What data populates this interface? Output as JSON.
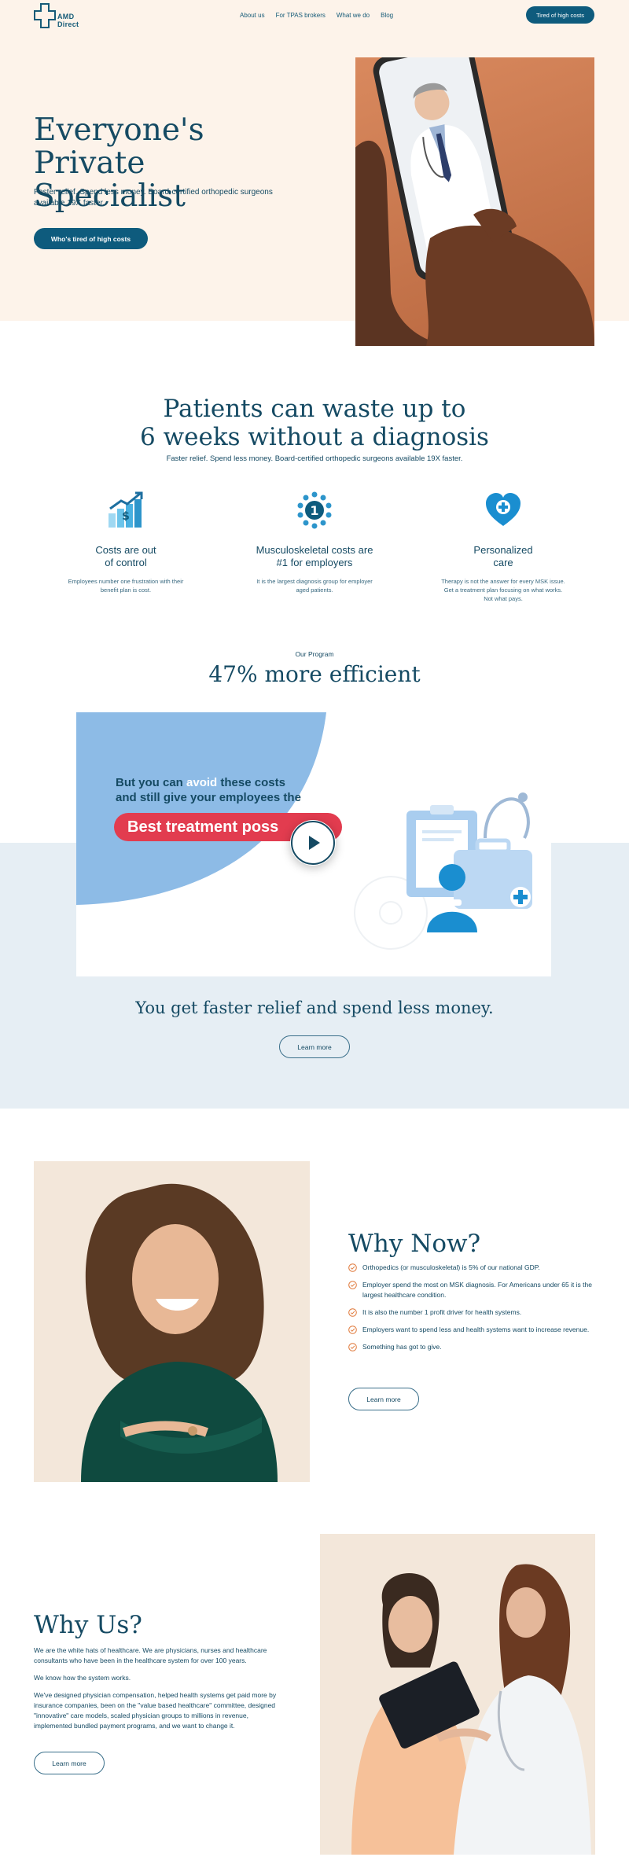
{
  "nav": {
    "logo_text": "AMD Direct",
    "links": [
      "About us",
      "For TPAS brokers",
      "What we do",
      "Blog"
    ],
    "cta": "Tired of high costs"
  },
  "hero": {
    "title_line1": "Everyone's",
    "title_line2": "Private Specialist",
    "subtitle": "Faster relief. Spend less money. Board-certified orthopedic surgeons available 19X faster.",
    "cta": "Who's tired of high costs"
  },
  "diagnosis": {
    "title_line1": "Patients can waste up to",
    "title_line2": "6 weeks without a diagnosis",
    "subtitle": "Faster relief. Spend less money. Board-certified orthopedic surgeons available 19X faster.",
    "features": [
      {
        "title_line1": "Costs are out",
        "title_line2": "of control",
        "desc": "Employees number one frustration with their benefit plan is cost."
      },
      {
        "title_line1": "Musculoskeletal costs are",
        "title_line2": "#1 for employers",
        "desc": "It is the largest diagnosis group for employer aged patients."
      },
      {
        "title_line1": "Personalized",
        "title_line2": "care",
        "desc": "Therapy is not the answer for every MSK issue. Get a treatment plan focusing on what works. Not what pays."
      }
    ]
  },
  "program": {
    "label": "Our Program",
    "title": "47% more efficient",
    "video_line1_a": "But you can ",
    "video_line1_hl": "avoid",
    "video_line1_b": " these costs",
    "video_line2": "and still give your employees the",
    "video_pill": "Best treatment poss",
    "tagline": "You get faster relief and spend less money.",
    "cta": "Learn more"
  },
  "why_now": {
    "title": "Why Now?",
    "items": [
      "Orthopedics (or musculoskeletal) is 5% of our national GDP.",
      "Employer spend the most on MSK diagnosis.  For Americans under 65 it is the largest healthcare condition.",
      "It is also the number 1 profit driver for health systems.",
      "Employers want to spend less and health systems want to increase revenue.",
      "Something has got to give."
    ],
    "cta": "Learn more"
  },
  "why_us": {
    "title": "Why Us?",
    "p1": "We are the white hats of healthcare. We are physicians, nurses and healthcare consultants who have been in the healthcare system for over 100 years.",
    "p2": "We know how the system works.",
    "p3": "We've designed physician compensation, helped health systems get paid more by insurance companies, been on the \"value based healthcare\" committee, designed \"innovative\" care models, scaled physician groups to millions in revenue, implemented bundled payment programs, and we want to change it.",
    "cta": "Learn more"
  },
  "colors": {
    "primary": "#0e5b7d",
    "text": "#154a63",
    "hero_bg": "#fdf3ea",
    "band_bg": "#e6eef4",
    "accent_red": "#e23c4f",
    "accent_orange": "#e07a3c"
  }
}
